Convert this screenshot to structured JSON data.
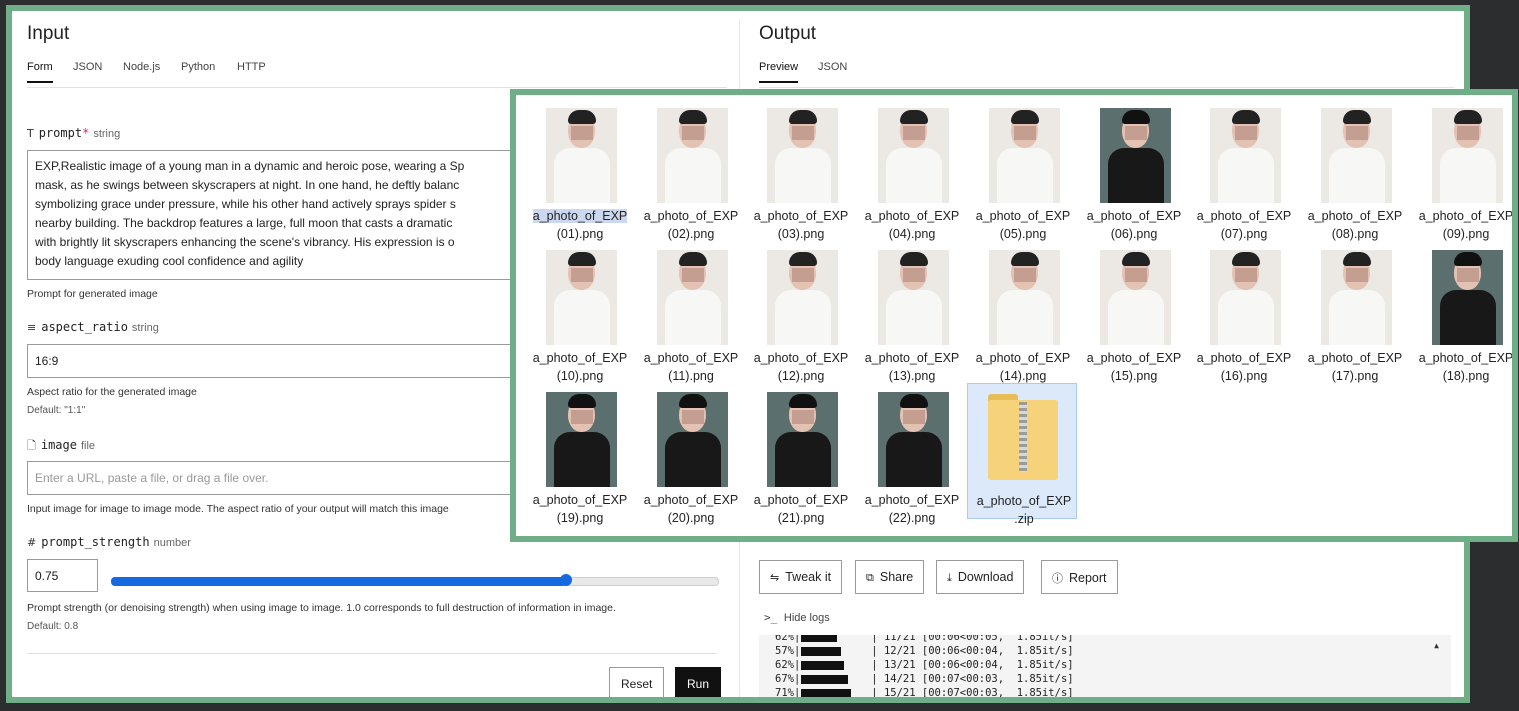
{
  "input": {
    "title": "Input",
    "tabs": [
      "Form",
      "JSON",
      "Node.js",
      "Python",
      "HTTP"
    ],
    "prompt": {
      "name": "prompt",
      "type": "string",
      "lines": [
        "EXP,Realistic image of a young man in a dynamic and heroic pose, wearing a Sp",
        "mask, as he swings between skyscrapers at night. In one hand, he deftly balanc",
        "symbolizing grace under pressure, while his other hand actively sprays spider s",
        "nearby building. The backdrop features a large, full moon that casts a dramatic",
        "with brightly lit skyscrapers enhancing the scene's vibrancy. His expression is o",
        "body language exuding cool confidence and agility"
      ],
      "help": "Prompt for generated image"
    },
    "aspect_ratio": {
      "name": "aspect_ratio",
      "type": "string",
      "value": "16:9",
      "help": "Aspect ratio for the generated image",
      "default": "Default: \"1:1\""
    },
    "image": {
      "name": "image",
      "type": "file",
      "placeholder": "Enter a URL, paste a file, or drag a file over.",
      "help": "Input image for image to image mode. The aspect ratio of your output will match this image"
    },
    "prompt_strength": {
      "name": "prompt_strength",
      "type": "number",
      "value": "0.75",
      "fraction": 0.75,
      "help": "Prompt strength (or denoising strength) when using image to image. 1.0 corresponds to full destruction of information in image.",
      "default": "Default: 0.8"
    },
    "reset_label": "Reset",
    "run_label": "Run"
  },
  "output": {
    "title": "Output",
    "tabs": [
      "Preview",
      "JSON"
    ],
    "actions": [
      "Tweak it",
      "Share",
      "Download",
      "Report"
    ],
    "logs_toggle": "Hide logs",
    "logs": [
      {
        "pct": "62%|",
        "text": "| 11/21 [00:06<00:05,  1.85it/s]",
        "bar": 0.52
      },
      {
        "pct": "57%|",
        "text": "| 12/21 [00:06<00:04,  1.85it/s]",
        "bar": 0.57
      },
      {
        "pct": "62%|",
        "text": "| 13/21 [00:06<00:04,  1.85it/s]",
        "bar": 0.62
      },
      {
        "pct": "67%|",
        "text": "| 14/21 [00:07<00:03,  1.85it/s]",
        "bar": 0.67
      },
      {
        "pct": "71%|",
        "text": "| 15/21 [00:07<00:03,  1.85it/s]",
        "bar": 0.71
      }
    ]
  },
  "files": [
    {
      "name": "a_photo_of_EXP",
      "suffix": "(01).png",
      "kind": "portrait"
    },
    {
      "name": "a_photo_of_EXP",
      "suffix": "(02).png",
      "kind": "portrait"
    },
    {
      "name": "a_photo_of_EXP",
      "suffix": "(03).png",
      "kind": "portrait"
    },
    {
      "name": "a_photo_of_EXP",
      "suffix": "(04).png",
      "kind": "portrait"
    },
    {
      "name": "a_photo_of_EXP",
      "suffix": "(05).png",
      "kind": "portrait"
    },
    {
      "name": "a_photo_of_EXP",
      "suffix": "(06).png",
      "kind": "dark"
    },
    {
      "name": "a_photo_of_EXP",
      "suffix": "(07).png",
      "kind": "portrait"
    },
    {
      "name": "a_photo_of_EXP",
      "suffix": "(08).png",
      "kind": "portrait"
    },
    {
      "name": "a_photo_of_EXP",
      "suffix": "(09).png",
      "kind": "portrait"
    },
    {
      "name": "a_photo_of_EXP",
      "suffix": "(10).png",
      "kind": "portrait"
    },
    {
      "name": "a_photo_of_EXP",
      "suffix": "(11).png",
      "kind": "portrait"
    },
    {
      "name": "a_photo_of_EXP",
      "suffix": "(12).png",
      "kind": "portrait"
    },
    {
      "name": "a_photo_of_EXP",
      "suffix": "(13).png",
      "kind": "portrait"
    },
    {
      "name": "a_photo_of_EXP",
      "suffix": "(14).png",
      "kind": "portrait"
    },
    {
      "name": "a_photo_of_EXP",
      "suffix": "(15).png",
      "kind": "portrait"
    },
    {
      "name": "a_photo_of_EXP",
      "suffix": "(16).png",
      "kind": "portrait"
    },
    {
      "name": "a_photo_of_EXP",
      "suffix": "(17).png",
      "kind": "portrait"
    },
    {
      "name": "a_photo_of_EXP",
      "suffix": "(18).png",
      "kind": "dark"
    },
    {
      "name": "a_photo_of_EXP",
      "suffix": "(19).png",
      "kind": "dark"
    },
    {
      "name": "a_photo_of_EXP",
      "suffix": "(20).png",
      "kind": "dark"
    },
    {
      "name": "a_photo_of_EXP",
      "suffix": "(21).png",
      "kind": "dark"
    },
    {
      "name": "a_photo_of_EXP",
      "suffix": "(22).png",
      "kind": "dark"
    },
    {
      "name": "a_photo_of_EXP",
      "suffix": ".zip",
      "kind": "zip"
    }
  ],
  "colors": {
    "accent": "#1769e0",
    "frame": "#6fae86",
    "selection": "#dbe9fa"
  },
  "icons": {
    "prompt": "text-type-icon",
    "aspect_ratio": "list-icon",
    "image": "file-icon",
    "prompt_strength": "hash-icon"
  }
}
